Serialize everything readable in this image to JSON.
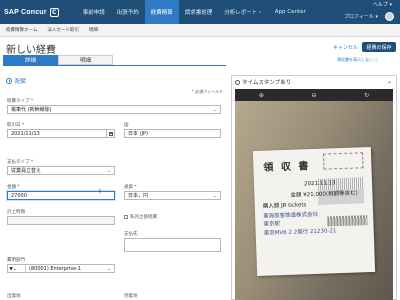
{
  "topbar": {
    "logo_text": "SAP Concur",
    "logo_mark": "C",
    "nav": [
      "事前申請",
      "出張予約",
      "経費精算",
      "請求書処理",
      "分析レポート・",
      "App Center"
    ],
    "help": "ヘルプ ▾",
    "profile": "プロフィール ▾"
  },
  "subnav": [
    "経費精算ホーム",
    "法人カード取引",
    "明細"
  ],
  "header": {
    "title": "新しい経費",
    "cancel": "キャンセル",
    "save": "経費の保存",
    "receipt_link": "領収書を表示しない ◻"
  },
  "tabs": [
    "詳細",
    "明細"
  ],
  "form": {
    "alloc": "配賦",
    "required_note": "* 必須フィールド",
    "expense_type_label": "経費タイプ *",
    "expense_type_value": "電車代 (新幹線除)",
    "date_label": "取引日 *",
    "date_value": "2021/11/13",
    "country_label": "国",
    "country_value": "日本 (JP)",
    "payment_label": "支払タイプ *",
    "payment_value": "従業員立替え",
    "amount_label": "金額 *",
    "amount_value": "27000",
    "currency_label": "通貨 *",
    "currency_value": "日本，円",
    "calc_label": "計上時期",
    "personal_label": "私的立替経費",
    "payee_label": "支払先",
    "project_label": "費用部門",
    "project_value": "(80001) Enterprise-1",
    "bottom_left_label": "出発地",
    "bottom_right_label": "到着地"
  },
  "panel": {
    "title": "タイムスタンプあり",
    "receipt": {
      "title": "領 収 書",
      "date": "2021.11.13",
      "amount": "金額 ¥21,000(税額等含む)",
      "ticket": "購入額  JR tickets",
      "issuer": "東海旅客鉄道株式会社",
      "place": "東京駅",
      "id": "東京MV6 2 2発行  21230-21"
    }
  },
  "colors": {
    "nav_bg": "#1f4e79",
    "accent": "#2f7ac7",
    "save_bg": "#1f4e79"
  }
}
